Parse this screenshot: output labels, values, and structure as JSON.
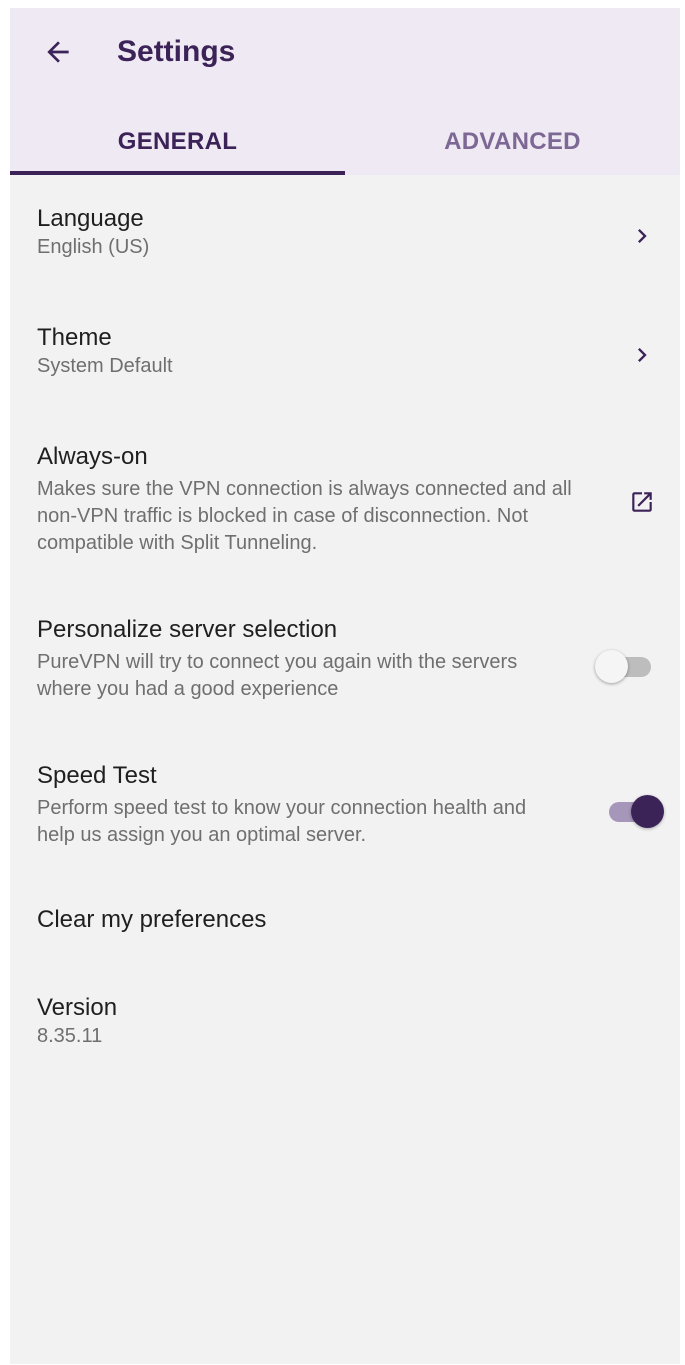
{
  "header": {
    "title": "Settings",
    "back_icon": "arrow-left-icon"
  },
  "tabs": [
    {
      "label": "GENERAL",
      "active": true
    },
    {
      "label": "ADVANCED",
      "active": false
    }
  ],
  "settings": {
    "language": {
      "title": "Language",
      "value": "English (US)"
    },
    "theme": {
      "title": "Theme",
      "value": "System Default"
    },
    "always_on": {
      "title": "Always-on",
      "description": "Makes sure the VPN connection is always connected and all non-VPN traffic is blocked in case of disconnection. Not compatible with Split Tunneling."
    },
    "personalize": {
      "title": "Personalize server selection",
      "description": "PureVPN will try to connect you again with the servers where you had a good experience",
      "enabled": false
    },
    "speed_test": {
      "title": "Speed Test",
      "description": "Perform speed test to know your connection health and help us assign you an optimal server.",
      "enabled": true
    },
    "clear": {
      "title": "Clear my preferences"
    },
    "version": {
      "title": "Version",
      "value": "8.35.11"
    }
  },
  "colors": {
    "accent": "#3b2257",
    "header_bg": "#efe9f3",
    "screen_bg": "#f3f2f3"
  }
}
